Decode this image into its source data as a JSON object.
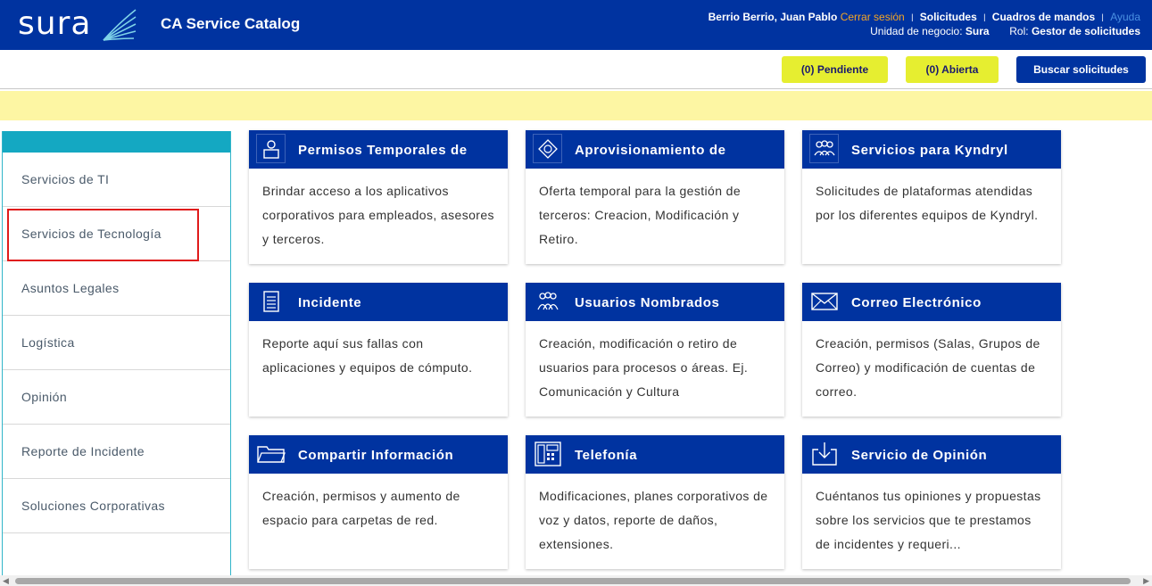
{
  "header": {
    "logo_text": "sura",
    "app_title": "CA Service Catalog",
    "user_name": "Berrio Berrio, Juan Pablo",
    "logout": "Cerrar sesión",
    "solicitudes": "Solicitudes",
    "cuadros": "Cuadros de mandos",
    "ayuda": "Ayuda",
    "unidad_label": "Unidad de negocio:",
    "unidad_value": "Sura",
    "rol_label": "Rol:",
    "rol_value": "Gestor de solicitudes"
  },
  "actions": {
    "pendiente": "(0) Pendiente",
    "abierta": "(0) Abierta",
    "buscar": "Buscar solicitudes"
  },
  "sidebar": {
    "items": [
      {
        "label": "Servicios de TI"
      },
      {
        "label": "Servicios de Tecnología"
      },
      {
        "label": "Asuntos Legales"
      },
      {
        "label": "Logística"
      },
      {
        "label": "Opinión"
      },
      {
        "label": "Reporte de Incidente"
      },
      {
        "label": "Soluciones Corporativas"
      }
    ]
  },
  "cards": [
    {
      "title": "Permisos Temporales de",
      "desc": "Brindar acceso a los aplicativos corporativos para empleados, asesores y terceros.",
      "icon": "person-icon"
    },
    {
      "title": "Aprovisionamiento de",
      "desc": "Oferta temporal para la gestión de terceros: Creacion, Modificación y Retiro.",
      "icon": "badge-icon"
    },
    {
      "title": "Servicios para Kyndryl",
      "desc": "Solicitudes de plataformas atendidas por los diferentes equipos de Kyndryl.",
      "icon": "group-icon"
    },
    {
      "title": "Incidente",
      "desc": "Reporte aquí sus fallas con aplicaciones y equipos de cómputo.",
      "icon": "document-icon"
    },
    {
      "title": "Usuarios Nombrados",
      "desc": "Creación, modificación o retiro de usuarios para procesos o áreas. Ej. Comunicación y Cultura",
      "icon": "users-icon"
    },
    {
      "title": "Correo Electrónico",
      "desc": "Creación, permisos (Salas, Grupos de Correo) y modificación de cuentas de correo.",
      "icon": "envelope-icon"
    },
    {
      "title": "Compartir Información",
      "desc": "Creación, permisos y aumento de espacio para carpetas de red.",
      "icon": "folder-icon"
    },
    {
      "title": "Telefonía",
      "desc": "Modificaciones, planes corporativos de voz y datos, reporte de daños, extensiones.",
      "icon": "phone-icon"
    },
    {
      "title": "Servicio de Opinión",
      "desc": "Cuéntanos tus opiniones y propuestas sobre los servicios que te prestamos de incidentes y requeri...",
      "icon": "download-icon"
    }
  ],
  "colors": {
    "brand_blue": "#0033a0",
    "yellow_button": "#e6ee30",
    "banner": "#fdf6a3",
    "sidebar_accent": "#14a8c2",
    "highlight": "#e01b1b"
  }
}
